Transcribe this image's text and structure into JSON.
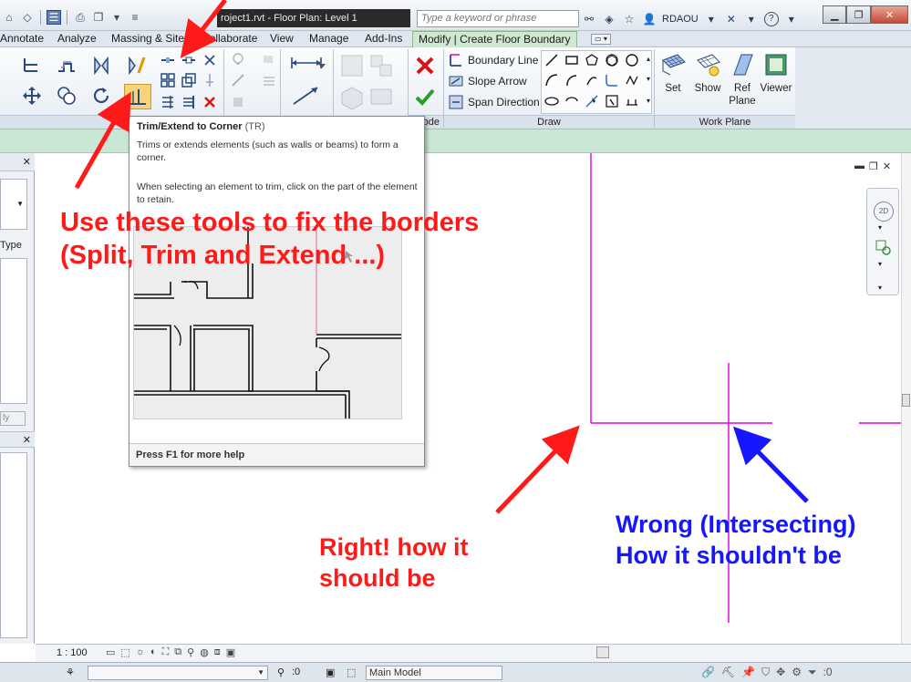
{
  "title_bar": {
    "doc_title": "roject1.rvt - Floor Plan: Level 1",
    "search_placeholder": "Type a keyword or phrase",
    "username": "RDAOU",
    "help_label": "?"
  },
  "tabs": [
    "Annotate",
    "Analyze",
    "Massing & Site",
    "Collaborate",
    "View",
    "Manage",
    "Add-Ins",
    "Modify | Create Floor Boundary"
  ],
  "ribbon": {
    "draw_commands": [
      "Boundary Line",
      "Slope Arrow",
      "Span Direction"
    ],
    "workplane_buttons": [
      {
        "label": "Set"
      },
      {
        "label": "Show"
      },
      {
        "label": "Ref Plane"
      },
      {
        "label": "Viewer"
      }
    ],
    "panel_labels": {
      "mode": "ode",
      "draw": "Draw",
      "work_plane": "Work Plane"
    }
  },
  "left_panel": {
    "type_label": "Type",
    "apply_label": "ly"
  },
  "tooltip": {
    "title": "Trim/Extend to Corner",
    "shortcut": "(TR)",
    "description": "Trims or extends elements (such as walls or beams) to form a corner.",
    "instruction": "When selecting an element to trim, click on the part of the element to retain.",
    "footer": "Press F1 for more help"
  },
  "annotations": {
    "tools_line1": "Use these tools to fix the borders",
    "tools_line2": "(Split, Trim and Extend ...)",
    "right_line1": "Right! how it",
    "right_line2": "should be",
    "wrong_line1": "Wrong (Intersecting)",
    "wrong_line2": "How it shouldn't be"
  },
  "view_bar": {
    "scale": "1 : 100"
  },
  "status_bar": {
    "workset_value": ":0",
    "model_value": "Main Model"
  },
  "colors": {
    "sketch_line": "#e000e0",
    "annotation_red": "#ff1a1a",
    "annotation_blue": "#1616ff",
    "contextual_tab": "#cfe8d0",
    "options_bar": "#c9e7d4"
  }
}
